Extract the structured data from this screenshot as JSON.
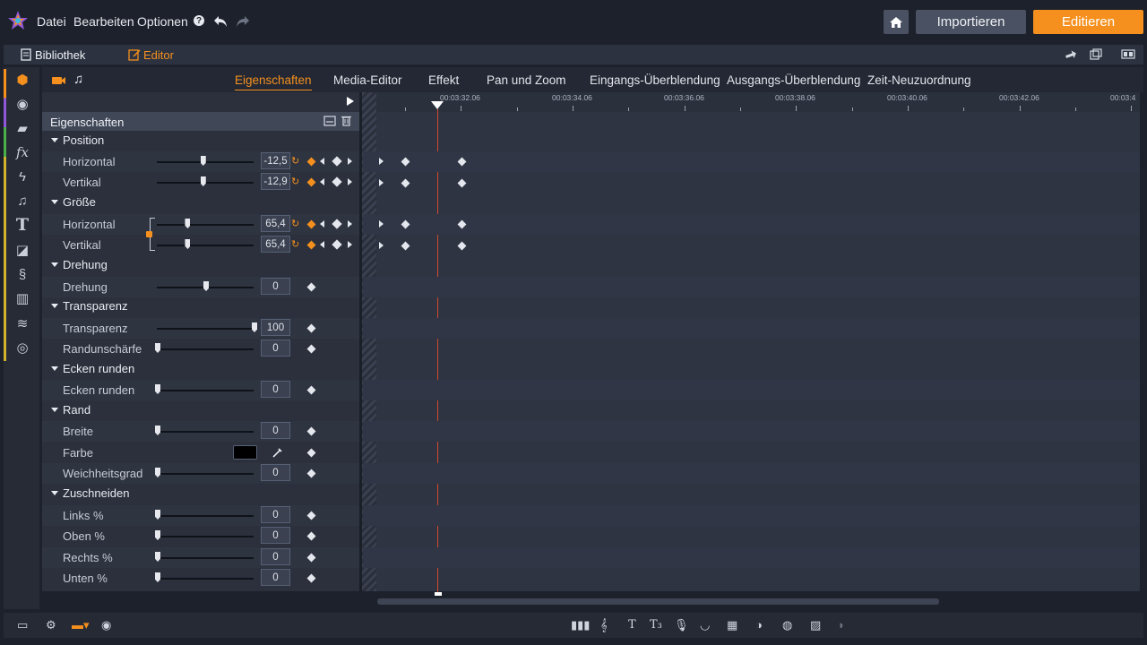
{
  "menu": {
    "file": "Datei",
    "edit": "Bearbeiten",
    "options": "Optionen",
    "help": "?"
  },
  "top_buttons": {
    "import": "Importieren",
    "edit": "Editieren"
  },
  "mode_tabs": {
    "library": "Bibliothek",
    "editor": "Editor"
  },
  "property_tabs": [
    "Eigenschaften",
    "Media-Editor",
    "Effekt",
    "Pan und Zoom",
    "Eingangs-Überblendung",
    "Ausgangs-Überblendung",
    "Zeit-Neuzuordnung"
  ],
  "panel_title": "Eigenschaften",
  "groups": {
    "position": "Position",
    "size": "Größe",
    "rotation": "Drehung",
    "transparency": "Transparenz",
    "corners": "Ecken runden",
    "border": "Rand",
    "crop": "Zuschneiden"
  },
  "items": {
    "pos_h": {
      "label": "Horizontal",
      "value": "-12,5",
      "level": 0.47
    },
    "pos_v": {
      "label": "Vertikal",
      "value": "-12,9",
      "level": 0.47
    },
    "size_h": {
      "label": "Horizontal",
      "value": "65,4",
      "level": 0.31
    },
    "size_v": {
      "label": "Vertikal",
      "value": "65,4",
      "level": 0.31
    },
    "rot": {
      "label": "Drehung",
      "value": "0",
      "level": 0.5
    },
    "trans": {
      "label": "Transparenz",
      "value": "100",
      "level": 1.0
    },
    "edge": {
      "label": "Randunschärfe",
      "value": "0",
      "level": 0
    },
    "corner": {
      "label": "Ecken runden",
      "value": "0",
      "level": 0
    },
    "width": {
      "label": "Breite",
      "value": "0",
      "level": 0
    },
    "color": {
      "label": "Farbe",
      "swatch": "#000000"
    },
    "soft": {
      "label": "Weichheitsgrad",
      "value": "0",
      "level": 0
    },
    "left": {
      "label": "Links %",
      "value": "0",
      "level": 0
    },
    "top": {
      "label": "Oben %",
      "value": "0",
      "level": 0
    },
    "right": {
      "label": "Rechts %",
      "value": "0",
      "level": 0
    },
    "bottom": {
      "label": "Unten %",
      "value": "0",
      "level": 0
    }
  },
  "timeline": {
    "ticks": [
      "00:03:32.06",
      "00:03:34.06",
      "00:03:36.06",
      "00:03:38.06",
      "00:03:40.06",
      "00:03:42.06",
      "00:03:4"
    ]
  },
  "colors": {
    "accent": "#f5901e",
    "panel": "#2b303c",
    "background": "#1d212b"
  }
}
